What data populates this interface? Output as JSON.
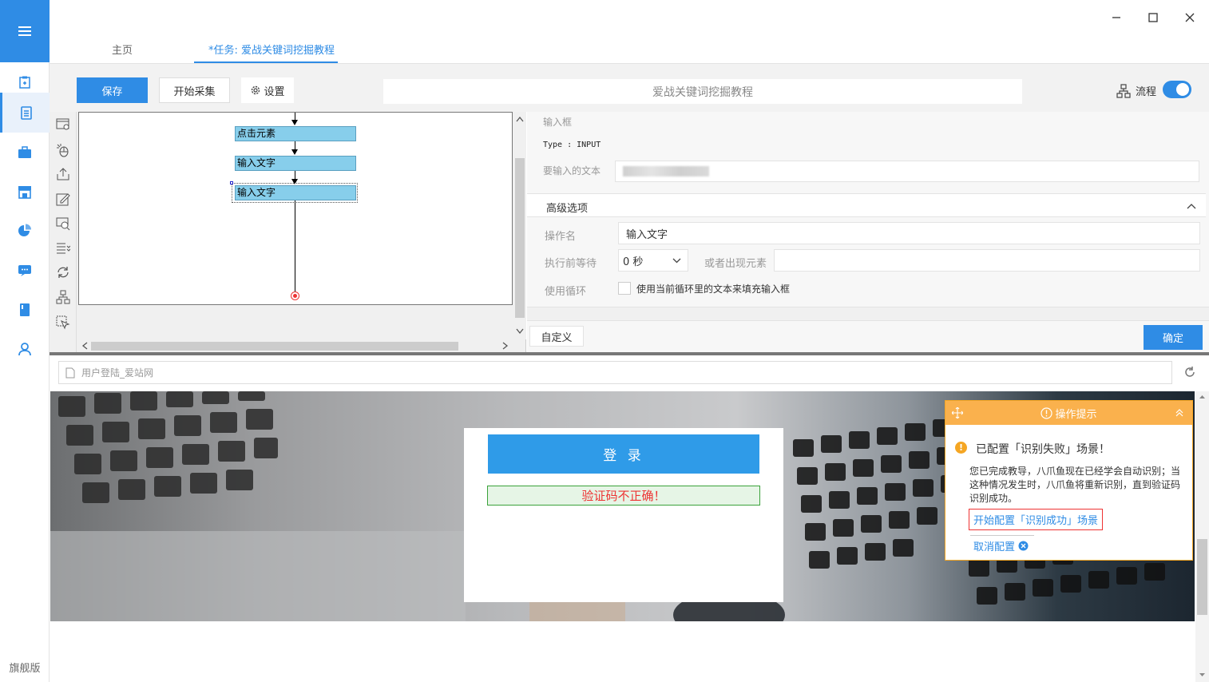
{
  "sidebar": {
    "menu_icon": "hamburger-icon",
    "items": [
      {
        "icon": "clipboard-icon"
      },
      {
        "icon": "document-icon"
      },
      {
        "icon": "briefcase-icon"
      },
      {
        "icon": "store-icon"
      },
      {
        "icon": "pie-chart-icon"
      },
      {
        "icon": "chat-icon"
      },
      {
        "icon": "book-icon"
      },
      {
        "icon": "user-icon"
      }
    ],
    "edition": "旗舰版"
  },
  "tabs": {
    "home": "主页",
    "task": "*任务: 爱战关键词挖掘教程"
  },
  "toolbar": {
    "save": "保存",
    "start": "开始采集",
    "settings": "设置",
    "task_title": "爱战关键词挖掘教程",
    "flow_label": "流程",
    "flow_enabled": true
  },
  "workflow": {
    "nodes": [
      "点击元素",
      "输入文字",
      "输入文字"
    ]
  },
  "props": {
    "section_title": "输入框",
    "type_line": "Type : INPUT",
    "text_label": "要输入的文本",
    "advanced_title": "高级选项",
    "op_name_label": "操作名",
    "op_name_value": "输入文字",
    "wait_label": "执行前等待",
    "wait_value": "0 秒",
    "or_label": "或者出现元素",
    "loop_label": "使用循环",
    "loop_checkbox_label": "使用当前循环里的文本来填充输入框",
    "custom_btn": "自定义",
    "ok_btn": "确定"
  },
  "browser": {
    "url_text": "用户登陆_爱站网",
    "login_btn": "登 录",
    "captcha_error": "验证码不正确！"
  },
  "tip": {
    "header": "操作提示",
    "title": "已配置「识别失败」场景！",
    "body": "您已完成教导，八爪鱼现在已经学会自动识别；当这种情况发生时，八爪鱼将重新识别，直到验证码识别成功。",
    "link": "开始配置「识别成功」场景",
    "cancel": "取消配置"
  },
  "colors": {
    "accent": "#2f8ce5",
    "tip_header": "#fab14d",
    "error": "#e33333"
  }
}
